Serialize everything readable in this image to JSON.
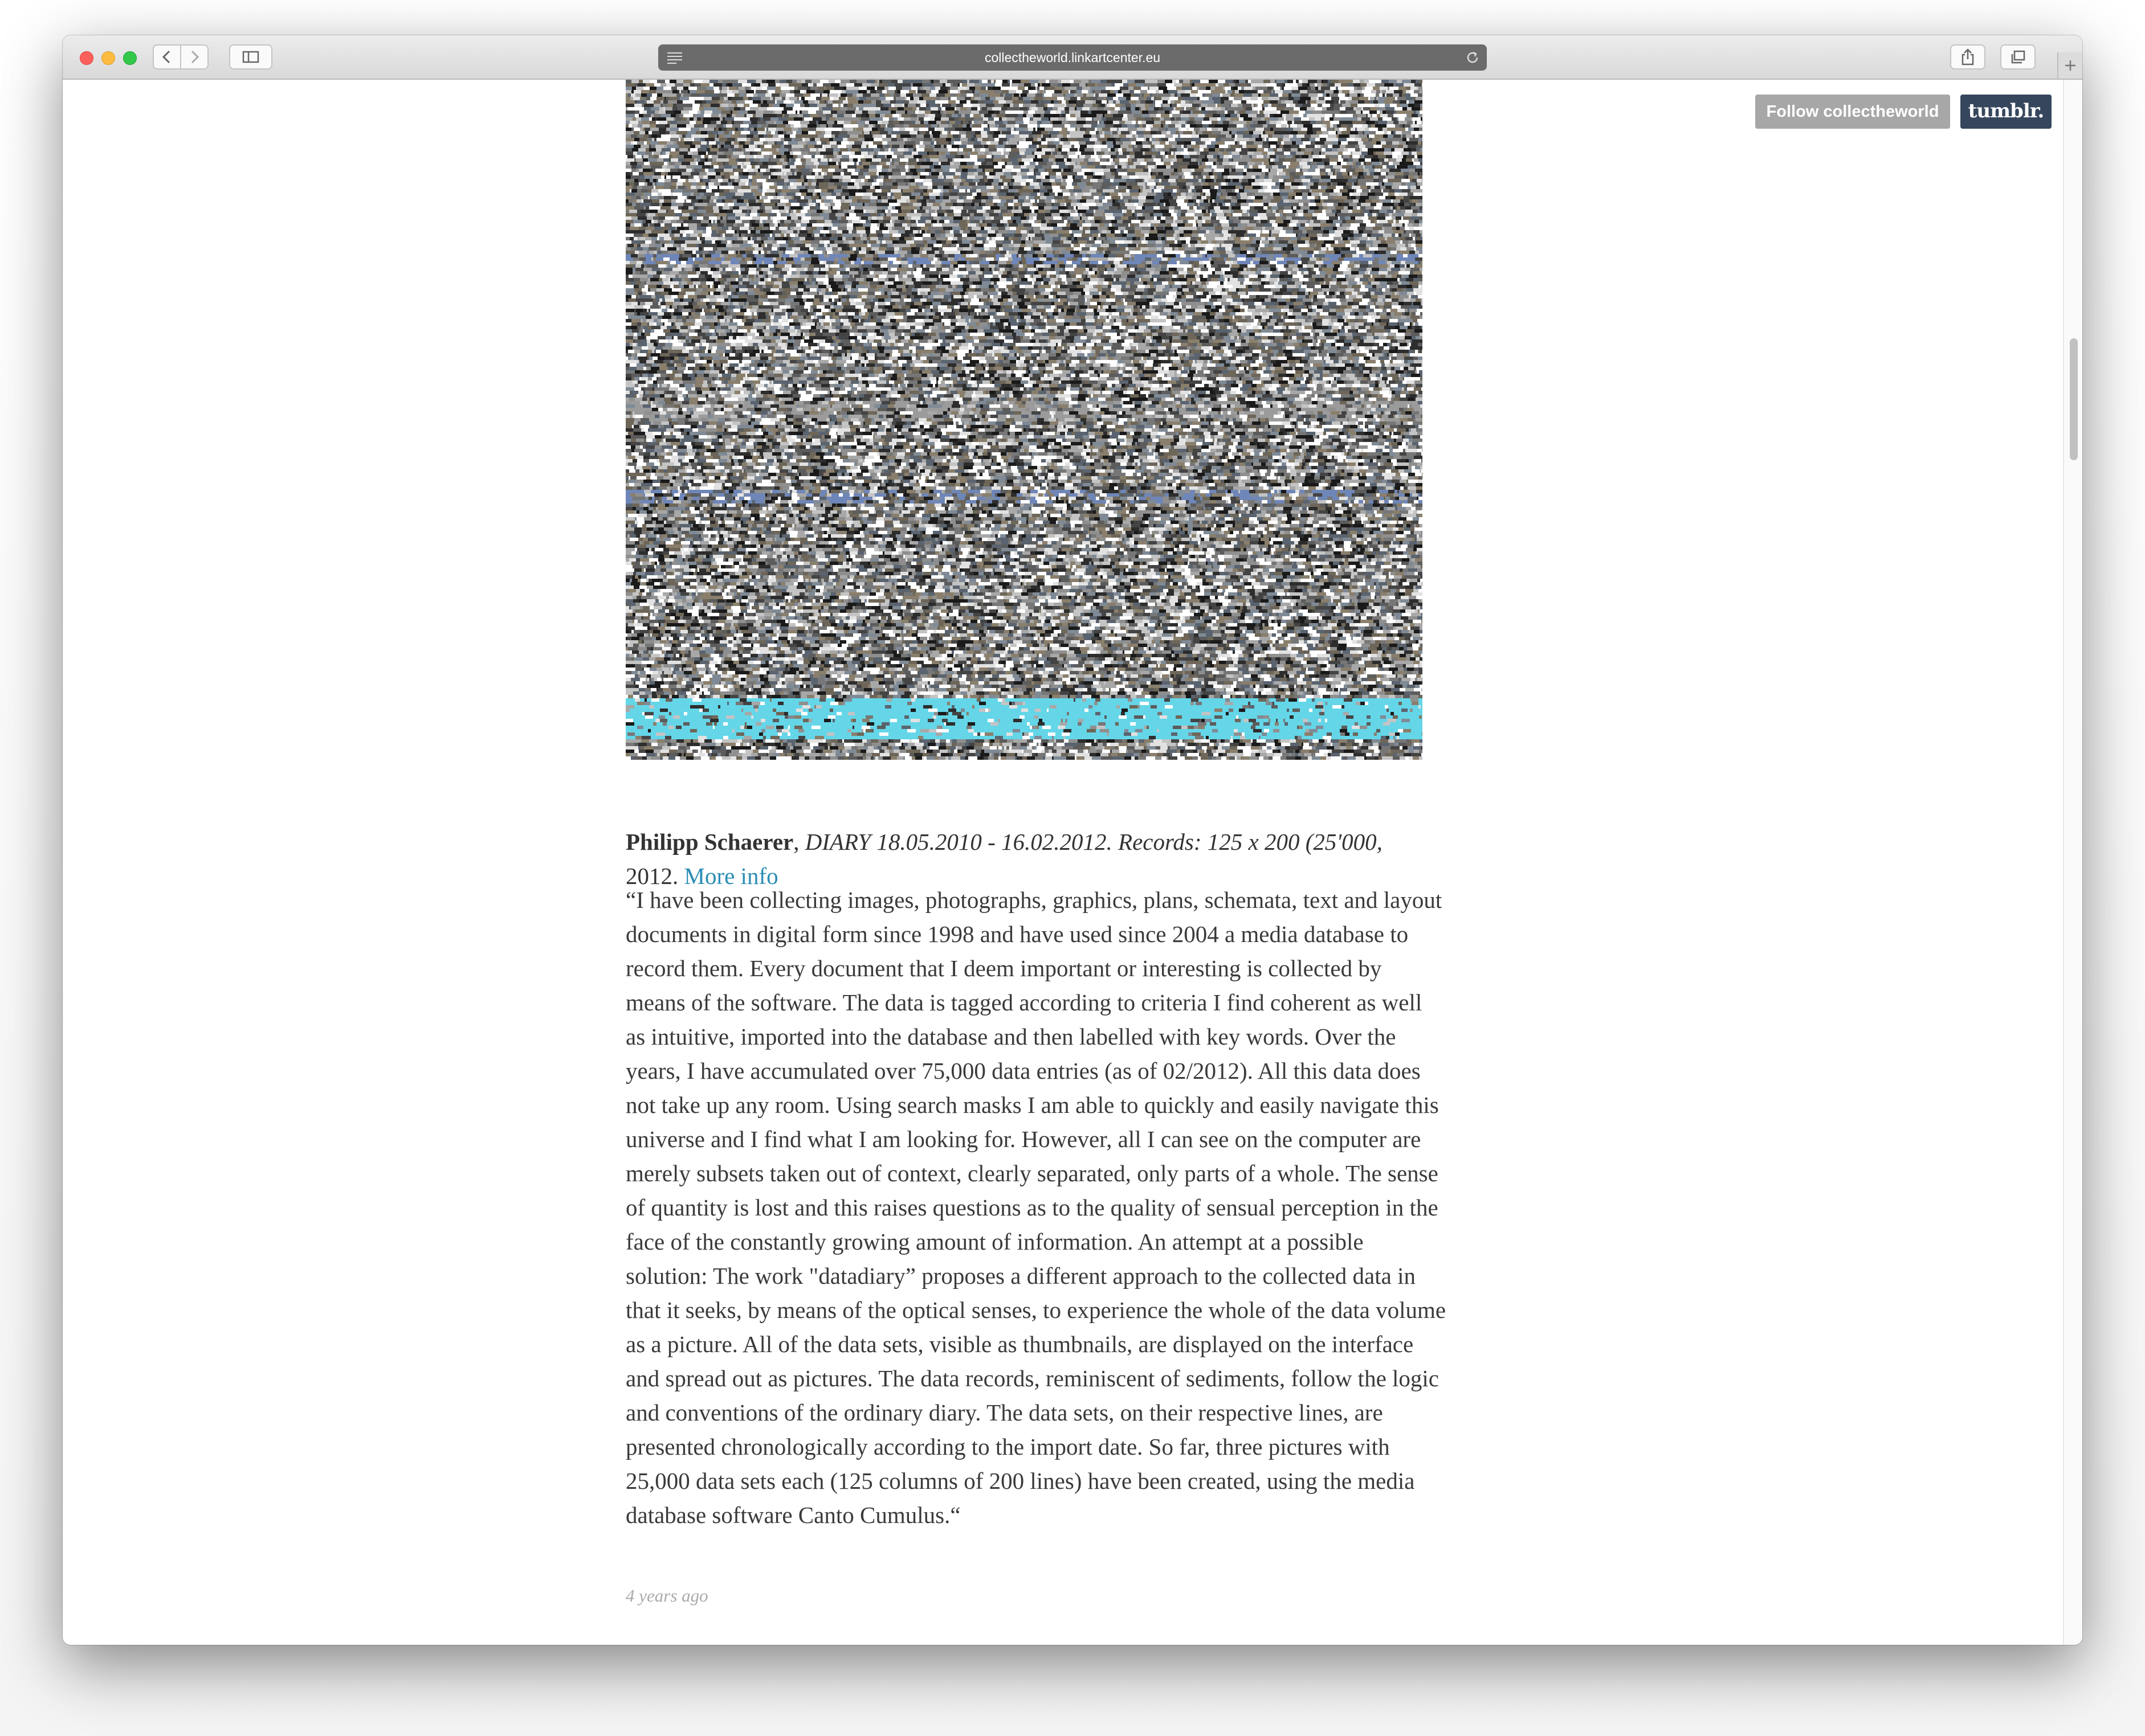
{
  "browser": {
    "url": "collectheworld.linkartcenter.eu"
  },
  "header": {
    "follow_label": "Follow collectheworld",
    "tumblr_label": "tumblr."
  },
  "post": {
    "caption": {
      "artist": "Philipp Schaerer",
      "separator": ", ",
      "title": "DIARY 18.05.2010 - 16.02.2012. Records: 125 x 200 (25'000,",
      "year": "2012. ",
      "more_info": "More info"
    },
    "quote_lines": [
      "“I have been collecting images, photographs, graphics, plans, schemata, text and layout",
      "documents in digital form since 1998 and have used since 2004 a media database to",
      "record them. Every document that I deem important or interesting is collected by",
      "means of the software. The data is tagged according to criteria I find coherent as well",
      "as intuitive, imported into the database and then labelled with key words. Over the",
      "years, I have accumulated over 75,000 data entries (as of 02/2012). All this data does",
      "not take up any room. Using search masks I am able to quickly and easily navigate this",
      "universe and I find what I am looking for. However, all I can see on the computer are",
      "merely subsets taken out of context, clearly separated, only parts of a whole. The sense",
      "of quantity is lost and this raises questions as to the quality of sensual perception in the",
      "face of the constantly growing amount of information. An attempt at a possible",
      "solution: The work \"datadiary” proposes a different approach to the collected data in",
      "that it seeks, by means of the optical senses, to experience the whole of the data volume",
      "as a picture. All of the data sets, visible as thumbnails, are displayed on the interface",
      "and spread out as pictures. The data records, reminiscent of sediments, follow the logic",
      "and conventions of the ordinary diary. The data sets, on their respective lines, are",
      "presented chronologically according to the import date. So far, three pictures with",
      "25,000 data sets each (125 columns of 200 lines) have been created, using the media",
      "database software Canto Cumulus.“"
    ],
    "timestamp": "4 years ago"
  },
  "icons": {
    "back": "chevron-left-icon",
    "forward": "chevron-right-icon",
    "sidebar": "sidebar-icon",
    "reader": "reader-icon",
    "reload": "reload-icon",
    "share": "share-icon",
    "tabs": "tabs-icon",
    "new_tab": "plus-icon"
  },
  "colors": {
    "link": "#2a8db5",
    "follow_button": "#a7a7a7",
    "tumblr_button": "#36465d",
    "art_accent": "#64d6e8"
  }
}
